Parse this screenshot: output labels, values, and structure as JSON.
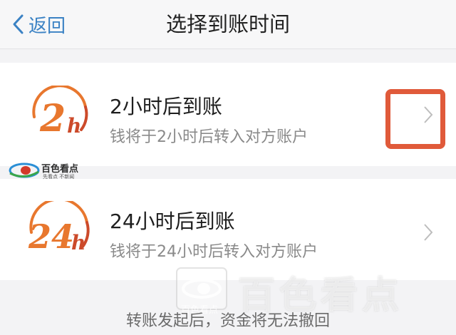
{
  "navbar": {
    "back_label": "返回",
    "title": "选择到账时间"
  },
  "options": [
    {
      "badge_number": "2",
      "badge_unit": "h",
      "title": "2小时后到账",
      "subtitle": "钱将于2小时后转入对方账户"
    },
    {
      "badge_number": "24",
      "badge_unit": "h",
      "title": "24小时后到账",
      "subtitle": "钱将于24小时后转入对方账户"
    }
  ],
  "footer": {
    "note": "转账发起后，资金将无法撤回"
  },
  "watermark": {
    "brand": "百色看点",
    "slogan": "先看点 不新闻"
  },
  "colors": {
    "accent_blue": "#3b82c4",
    "badge_orange": "#e8772e",
    "badge_red": "#cc4a2a",
    "highlight_red": "#e05a3a"
  },
  "icons": [
    "chevron-left-icon",
    "chevron-right-icon",
    "clock-2h-icon",
    "clock-24h-icon"
  ]
}
